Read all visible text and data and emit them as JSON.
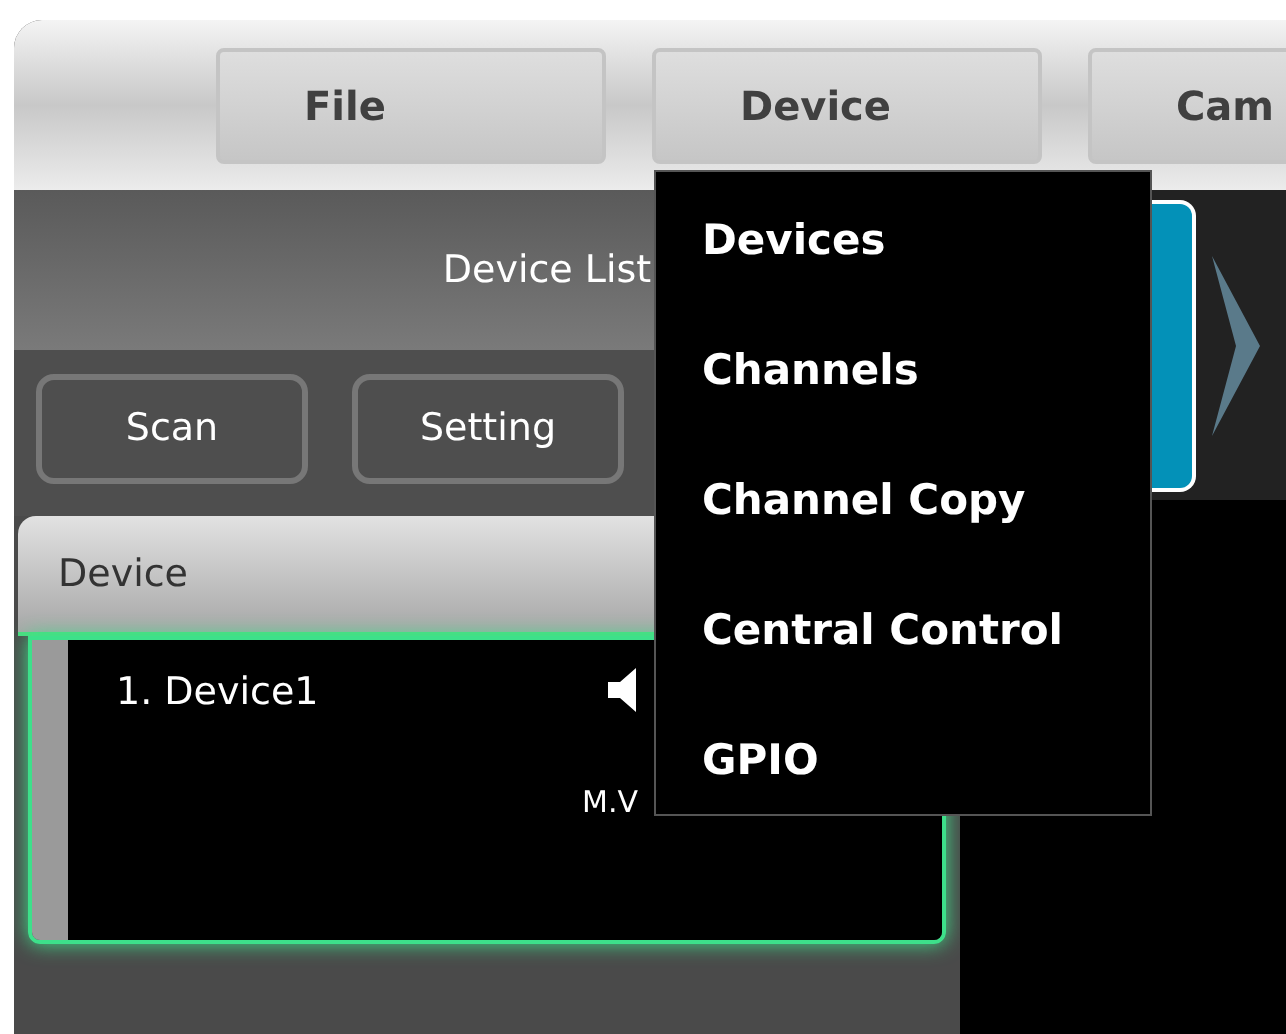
{
  "menu_bar": [
    {
      "label": "File"
    },
    {
      "label": "Device"
    },
    {
      "label": "Cam"
    }
  ],
  "device_panel": {
    "title": "Device List",
    "buttons": [
      "Scan",
      "Setting"
    ],
    "column_header": "Device",
    "devices": [
      {
        "name": "1. Device1",
        "detail": "M.V",
        "selected": true
      }
    ]
  },
  "dropdown": {
    "items": [
      "Devices",
      "Channels",
      "Channel Copy",
      "Central Control",
      "GPIO"
    ]
  }
}
